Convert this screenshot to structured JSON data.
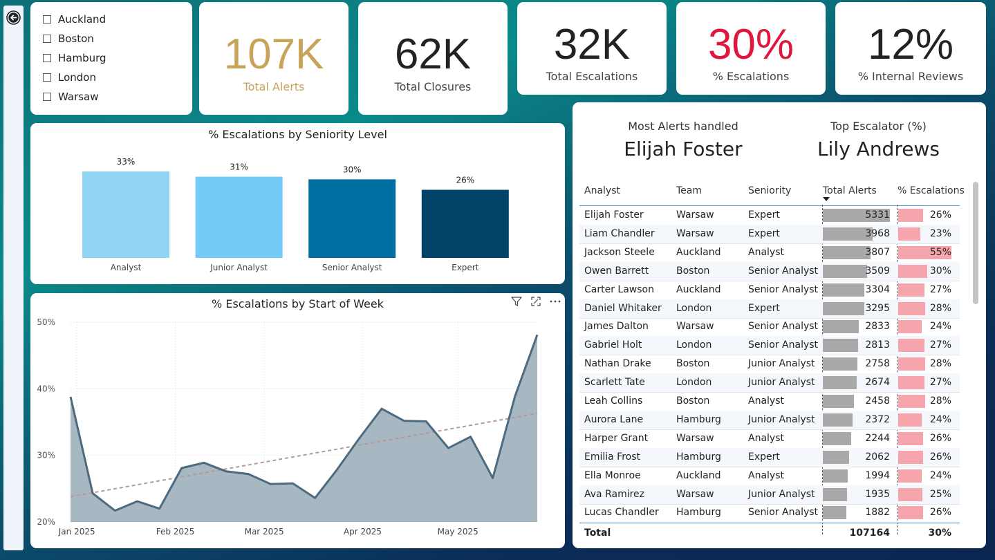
{
  "slicer": {
    "items": [
      {
        "label": "Auckland",
        "checked": false
      },
      {
        "label": "Boston",
        "checked": false
      },
      {
        "label": "Hamburg",
        "checked": false
      },
      {
        "label": "London",
        "checked": false
      },
      {
        "label": "Warsaw",
        "checked": false
      }
    ]
  },
  "kpis": {
    "total_alerts": {
      "value": "107K",
      "label": "Total Alerts",
      "color": "#c8a45a"
    },
    "total_closures": {
      "value": "62K",
      "label": "Total Closures"
    },
    "total_escalations": {
      "value": "32K",
      "label": "Total Escalations"
    },
    "pct_escalations": {
      "value": "30%",
      "label": "% Escalations",
      "color": "#e0163e"
    },
    "pct_internal_reviews": {
      "value": "12%",
      "label": "% Internal Reviews"
    }
  },
  "highlights": {
    "most_alerts": {
      "label": "Most Alerts handled",
      "value": "Elijah Foster"
    },
    "top_escalator": {
      "label": "Top Escalator (%)",
      "value": "Lily Andrews"
    }
  },
  "table": {
    "headers": [
      "Analyst",
      "Team",
      "Seniority",
      "Total Alerts",
      "% Escalations"
    ],
    "sort_column": "Total Alerts",
    "rows": [
      {
        "analyst": "Elijah Foster",
        "team": "Warsaw",
        "seniority": "Expert",
        "alerts": "5331",
        "alerts_n": 5331,
        "esc": "26%",
        "esc_n": 26
      },
      {
        "analyst": "Liam Chandler",
        "team": "Warsaw",
        "seniority": "Expert",
        "alerts": "3968",
        "alerts_n": 3968,
        "esc": "23%",
        "esc_n": 23
      },
      {
        "analyst": "Jackson Steele",
        "team": "Auckland",
        "seniority": "Analyst",
        "alerts": "3807",
        "alerts_n": 3807,
        "esc": "55%",
        "esc_n": 55
      },
      {
        "analyst": "Owen Barrett",
        "team": "Boston",
        "seniority": "Senior Analyst",
        "alerts": "3509",
        "alerts_n": 3509,
        "esc": "30%",
        "esc_n": 30
      },
      {
        "analyst": "Carter Lawson",
        "team": "Auckland",
        "seniority": "Senior Analyst",
        "alerts": "3304",
        "alerts_n": 3304,
        "esc": "27%",
        "esc_n": 27
      },
      {
        "analyst": "Daniel Whitaker",
        "team": "London",
        "seniority": "Expert",
        "alerts": "3295",
        "alerts_n": 3295,
        "esc": "28%",
        "esc_n": 28
      },
      {
        "analyst": "James Dalton",
        "team": "Warsaw",
        "seniority": "Senior Analyst",
        "alerts": "2833",
        "alerts_n": 2833,
        "esc": "24%",
        "esc_n": 24
      },
      {
        "analyst": "Gabriel Holt",
        "team": "London",
        "seniority": "Senior Analyst",
        "alerts": "2813",
        "alerts_n": 2813,
        "esc": "27%",
        "esc_n": 27
      },
      {
        "analyst": "Nathan Drake",
        "team": "Boston",
        "seniority": "Junior Analyst",
        "alerts": "2758",
        "alerts_n": 2758,
        "esc": "28%",
        "esc_n": 28
      },
      {
        "analyst": "Scarlett Tate",
        "team": "London",
        "seniority": "Junior Analyst",
        "alerts": "2674",
        "alerts_n": 2674,
        "esc": "27%",
        "esc_n": 27
      },
      {
        "analyst": "Leah Collins",
        "team": "Boston",
        "seniority": "Analyst",
        "alerts": "2458",
        "alerts_n": 2458,
        "esc": "28%",
        "esc_n": 28
      },
      {
        "analyst": "Aurora Lane",
        "team": "Hamburg",
        "seniority": "Junior Analyst",
        "alerts": "2372",
        "alerts_n": 2372,
        "esc": "24%",
        "esc_n": 24
      },
      {
        "analyst": "Harper Grant",
        "team": "Warsaw",
        "seniority": "Analyst",
        "alerts": "2244",
        "alerts_n": 2244,
        "esc": "26%",
        "esc_n": 26
      },
      {
        "analyst": "Emilia Frost",
        "team": "Hamburg",
        "seniority": "Expert",
        "alerts": "2062",
        "alerts_n": 2062,
        "esc": "26%",
        "esc_n": 26
      },
      {
        "analyst": "Ella Monroe",
        "team": "Auckland",
        "seniority": "Analyst",
        "alerts": "1994",
        "alerts_n": 1994,
        "esc": "24%",
        "esc_n": 24
      },
      {
        "analyst": "Ava Ramirez",
        "team": "Warsaw",
        "seniority": "Junior Analyst",
        "alerts": "1935",
        "alerts_n": 1935,
        "esc": "25%",
        "esc_n": 25
      },
      {
        "analyst": "Lucas Chandler",
        "team": "Hamburg",
        "seniority": "Senior Analyst",
        "alerts": "1882",
        "alerts_n": 1882,
        "esc": "26%",
        "esc_n": 26
      }
    ],
    "total": {
      "label": "Total",
      "alerts": "107164",
      "esc": "30%"
    }
  },
  "chart_data": [
    {
      "type": "bar",
      "title": "% Escalations by Seniority Level",
      "categories": [
        "Analyst",
        "Junior Analyst",
        "Senior Analyst",
        "Expert"
      ],
      "values": [
        33,
        31,
        30,
        26
      ],
      "labels": [
        "33%",
        "31%",
        "30%",
        "26%"
      ],
      "colors": [
        "#92d5f2",
        "#74cbf7",
        "#006fa2",
        "#004268"
      ],
      "ylim": [
        0,
        33
      ]
    },
    {
      "type": "area",
      "title": "% Escalations by Start of Week",
      "x": [
        "2024-12-30",
        "2025-01-06",
        "2025-01-13",
        "2025-01-20",
        "2025-01-27",
        "2025-02-03",
        "2025-02-10",
        "2025-02-17",
        "2025-02-24",
        "2025-03-03",
        "2025-03-10",
        "2025-03-17",
        "2025-03-24",
        "2025-03-31",
        "2025-04-07",
        "2025-04-14",
        "2025-04-21",
        "2025-04-28",
        "2025-05-05",
        "2025-05-12",
        "2025-05-19",
        "2025-05-26"
      ],
      "values": [
        38.8,
        24.3,
        21.7,
        23.1,
        22.0,
        28.1,
        28.9,
        27.6,
        27.2,
        25.7,
        25.8,
        23.6,
        27.9,
        32.6,
        37.0,
        35.2,
        35.1,
        31.1,
        32.8,
        26.6,
        38.9,
        48.1
      ],
      "trend": [
        23.8,
        36.3
      ],
      "yticks": [
        "20%",
        "30%",
        "40%",
        "50%"
      ],
      "xticks": [
        "Jan 2025",
        "Feb 2025",
        "Mar 2025",
        "Apr 2025",
        "May 2025"
      ],
      "ylim": [
        20,
        50
      ],
      "line_color": "#4d6a7e",
      "fill_color": "#a8b8c2",
      "trend_color": "#b49999"
    }
  ]
}
